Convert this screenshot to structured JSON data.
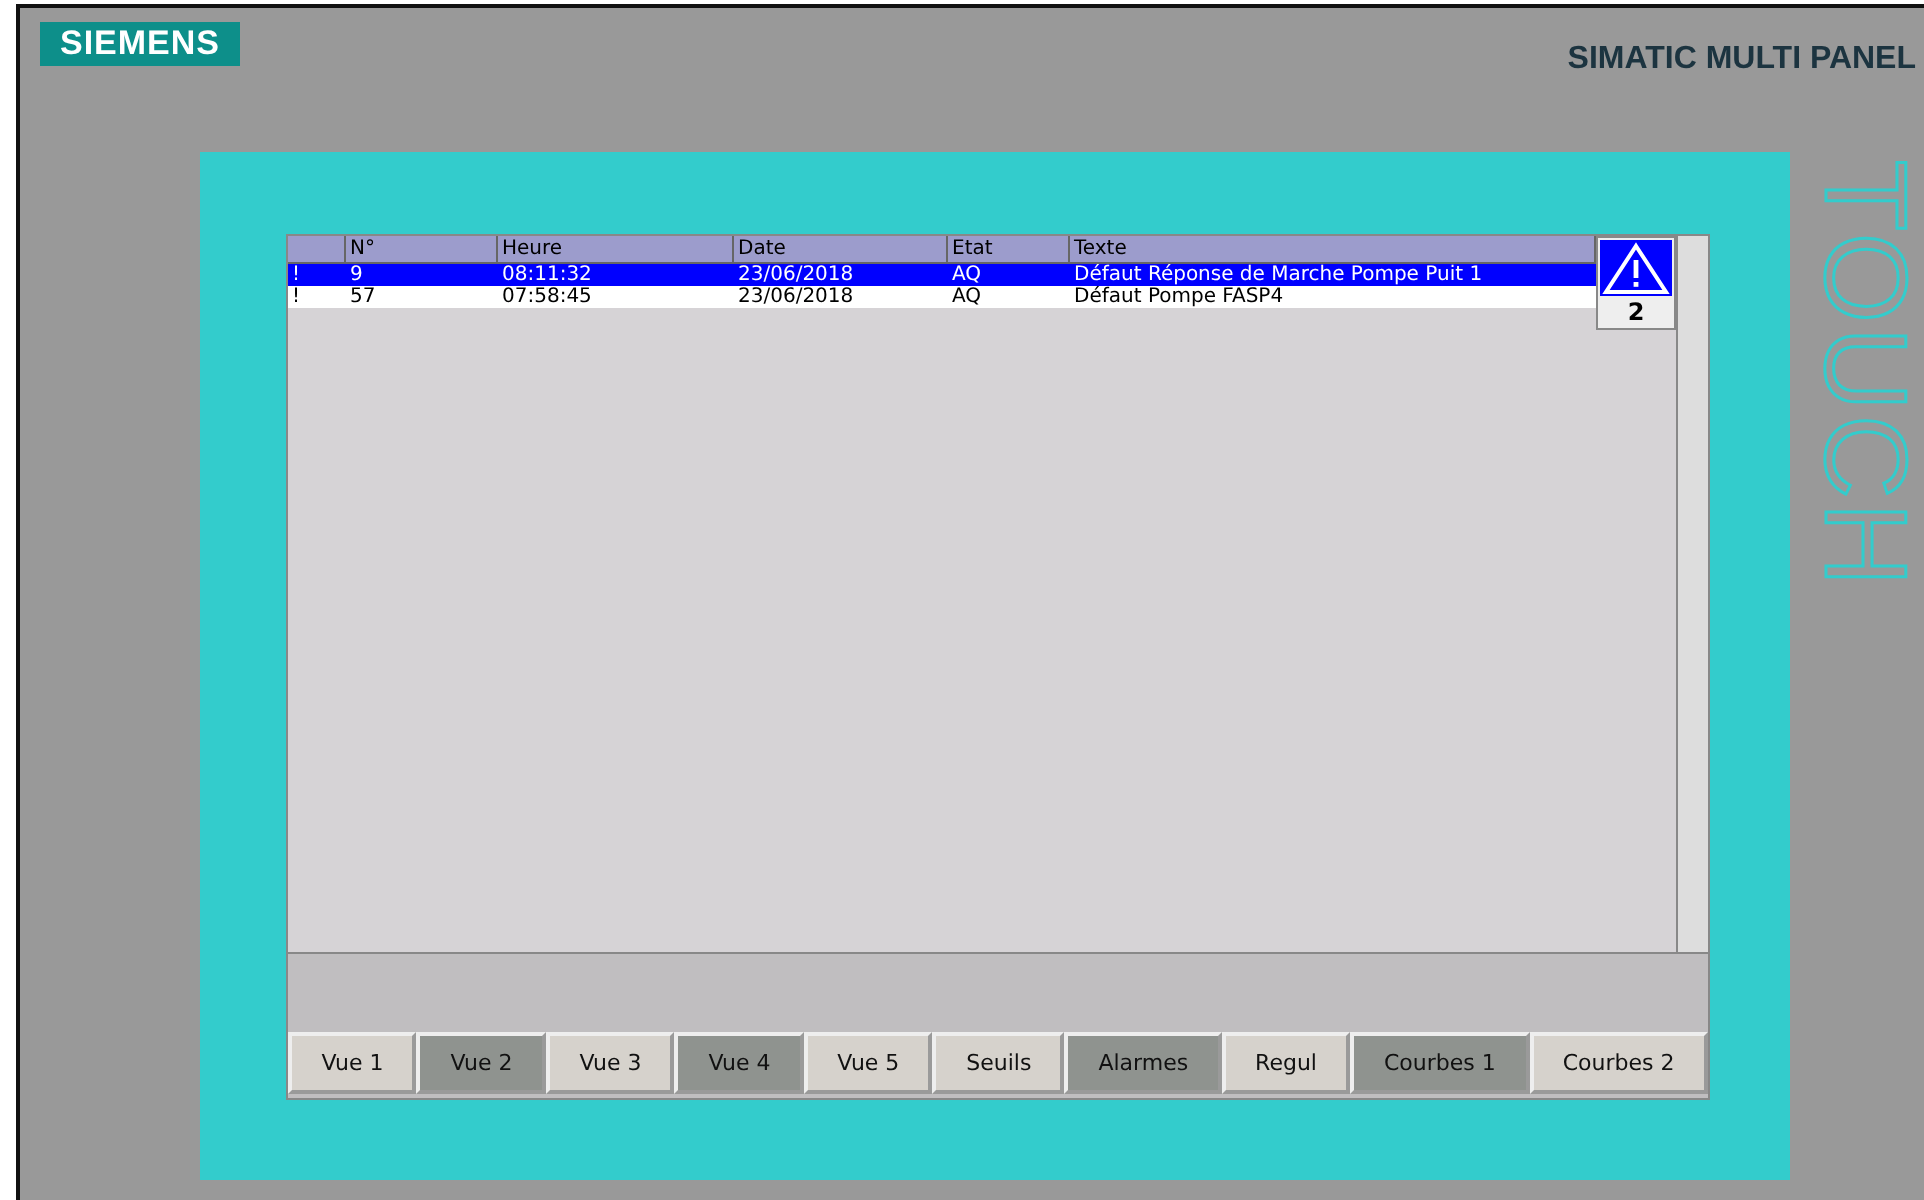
{
  "brand": "SIEMENS",
  "model": "SIMATIC MULTI PANEL",
  "side_label": "TOUCH",
  "alarm_table": {
    "columns": [
      "",
      "N°",
      "Heure",
      "Date",
      "Etat",
      "Texte"
    ],
    "rows": [
      {
        "selected": true,
        "cells": [
          "!",
          "9",
          "08:11:32",
          "23/06/2018",
          "AQ",
          "Défaut Réponse de Marche Pompe Puit 1"
        ]
      },
      {
        "selected": false,
        "cells": [
          "!",
          "57",
          "07:58:45",
          "23/06/2018",
          "AQ",
          "Défaut Pompe FASP4"
        ]
      }
    ]
  },
  "alarm_indicator": {
    "count": "2"
  },
  "nav_buttons": [
    {
      "label": "Vue 1",
      "dark": false
    },
    {
      "label": "Vue 2",
      "dark": true
    },
    {
      "label": "Vue 3",
      "dark": false
    },
    {
      "label": "Vue 4",
      "dark": true
    },
    {
      "label": "Vue 5",
      "dark": false
    },
    {
      "label": "Seuils",
      "dark": false
    },
    {
      "label": "Alarmes",
      "dark": true
    },
    {
      "label": "Regul",
      "dark": false
    },
    {
      "label": "Courbes 1",
      "dark": true
    },
    {
      "label": "Courbes 2",
      "dark": false
    }
  ]
}
